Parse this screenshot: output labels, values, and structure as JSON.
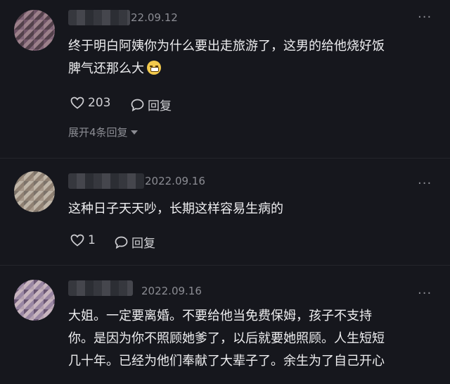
{
  "comments": [
    {
      "date": "22.09.12",
      "text_lines": [
        "终于明白阿姨你为什么要出走旅游了，这男的给他烧好饭",
        "脾气还那么大"
      ],
      "like_count": "203",
      "reply_label": "回复",
      "expand_label": "展开4条回复"
    },
    {
      "date": "2022.09.16",
      "text_lines": [
        "这种日子天天吵，长期这样容易生病的"
      ],
      "like_count": "1",
      "reply_label": "回复"
    },
    {
      "date": "2022.09.16",
      "text_lines": [
        "大姐。一定要离婚。不要给他当免费保姆，孩子不支持",
        "你。是因为你不照顾她爹了，以后就要她照顾。人生短短",
        "几十年。已经为他们奉献了大辈子了。余生为了自己开心"
      ]
    }
  ],
  "more_icon": "more-dots-icon",
  "colors": {
    "background": "#16171d",
    "text": "#ededef",
    "muted": "#8b8c93"
  }
}
